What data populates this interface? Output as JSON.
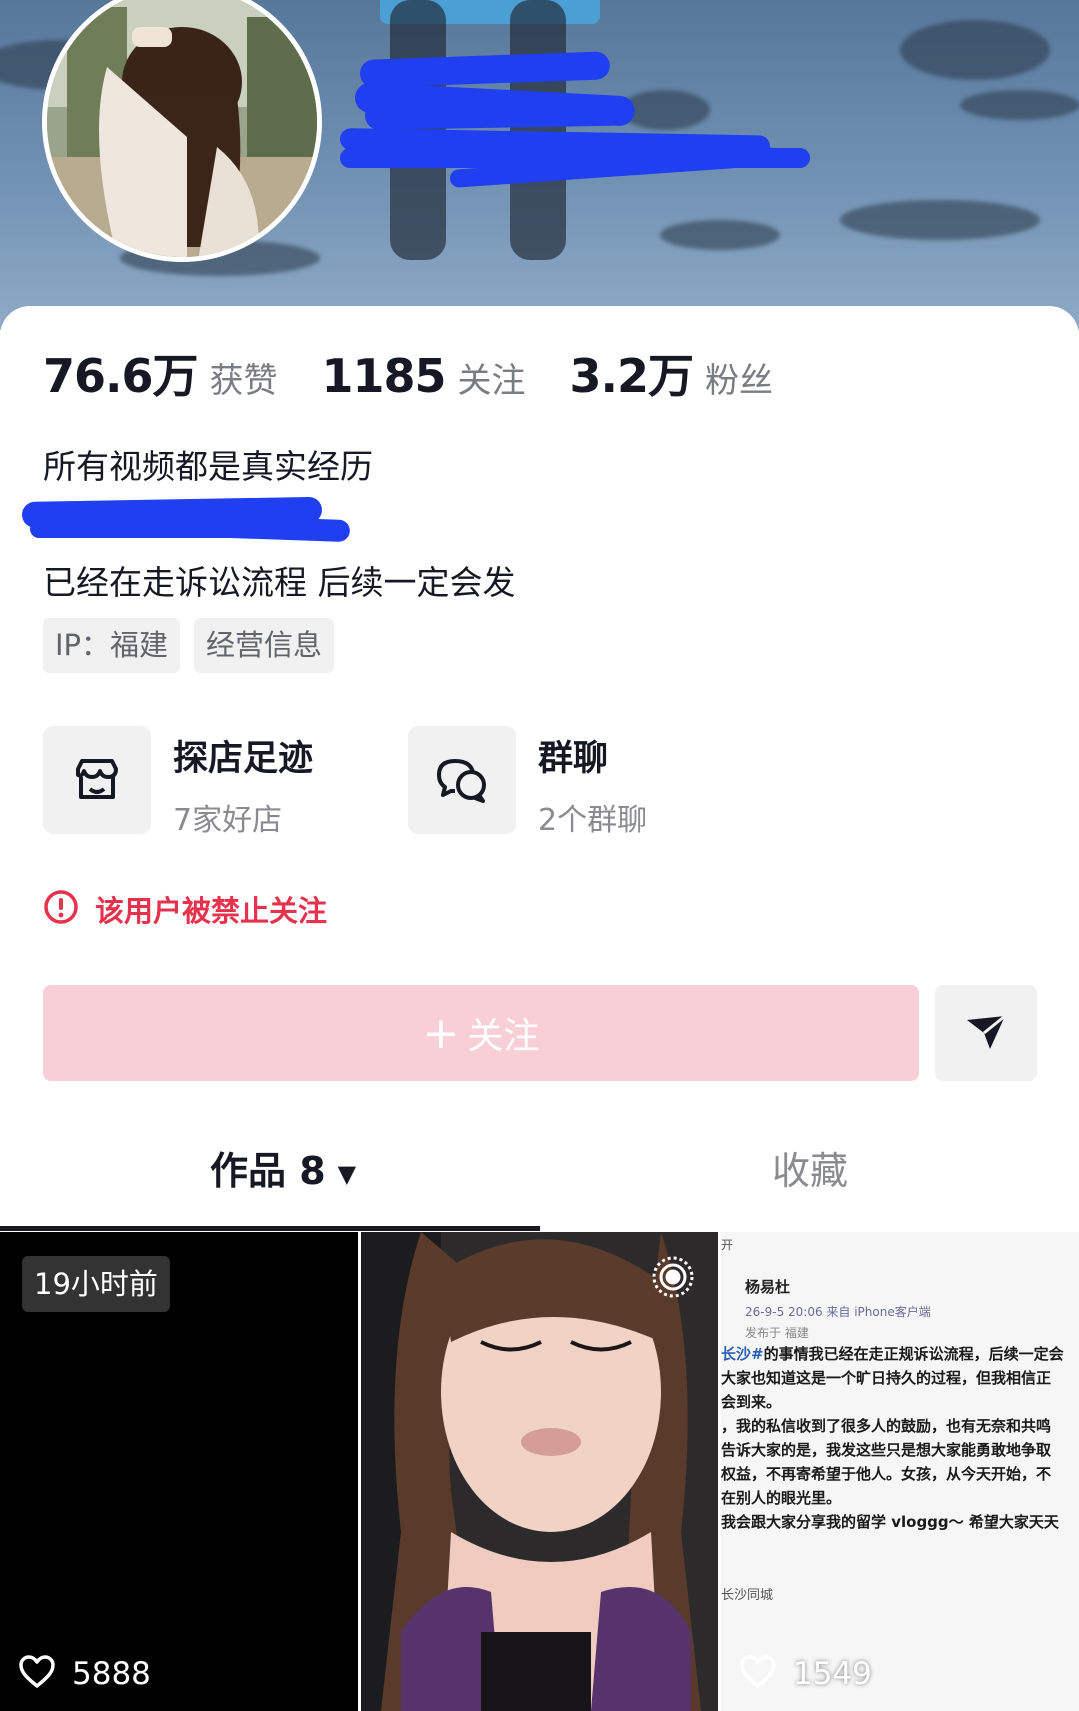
{
  "profile": {
    "stats": [
      {
        "value": "76.6万",
        "label": "获赞"
      },
      {
        "value": "1185",
        "label": "关注"
      },
      {
        "value": "3.2万",
        "label": "粉丝"
      }
    ],
    "bio_line1": "所有视频都是真实经历",
    "bio_line3": "已经在走诉讼流程 后续一定会发",
    "tags": [
      "IP：福建",
      "经营信息"
    ]
  },
  "features": [
    {
      "title": "探店足迹",
      "subtitle": "7家好店",
      "icon": "store-icon"
    },
    {
      "title": "群聊",
      "subtitle": "2个群聊",
      "icon": "chat-bubbles-icon"
    }
  ],
  "warning": {
    "text": "该用户被禁止关注",
    "icon": "alert-circle-icon"
  },
  "actions": {
    "follow_label": "关注",
    "follow_plus": "+",
    "share_icon": "send-icon"
  },
  "tabs": {
    "works_label": "作品 8",
    "favorites_label": "收藏"
  },
  "videos": [
    {
      "badge": "19小时前",
      "likes": "5888"
    },
    {
      "likes": ""
    },
    {
      "likes": "1549"
    }
  ],
  "post_screenshot": {
    "top": "开",
    "author": "杨易杜",
    "meta": "26-9-5 20:06  来自 iPhone客户端",
    "location": "发布于 福建",
    "line1_tag": "长沙#",
    "line1": "的事情我已经在走正规诉讼流程，后续一定会",
    "line2": "大家也知道这是一个旷日持久的过程，但我相信正",
    "line3": "会到来。",
    "line4": "，我的私信收到了很多人的鼓励，也有无奈和共鸣",
    "line5": "告诉大家的是，我发这些只是想大家能勇敢地争取",
    "line6": "权益，不再寄希望于他人。女孩，从今天开始，不",
    "line7": "在别人的眼光里。",
    "line8": "我会跟大家分享我的留学 vloggg～ 希望大家天天",
    "foot": "长沙同城"
  },
  "colors": {
    "accent_red": "#e6324d",
    "follow_disabled": "#f8cfd6",
    "text_primary": "#161823",
    "text_secondary": "#7a7c83"
  }
}
